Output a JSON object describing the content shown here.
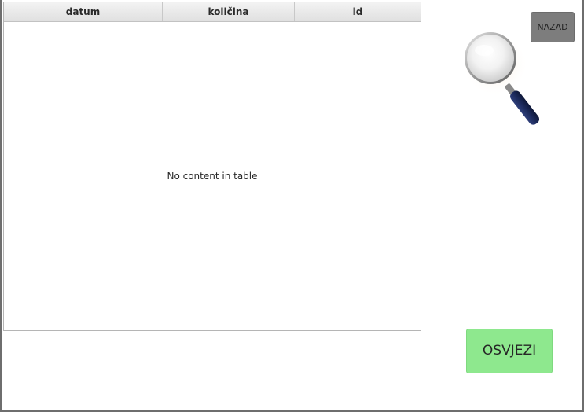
{
  "table": {
    "columns": [
      "datum",
      "količina",
      "id"
    ],
    "rows": [],
    "placeholder": "No content in table"
  },
  "buttons": {
    "back_label": "NAZAD",
    "refresh_label": "OSVJEZI"
  },
  "icons": {
    "search": "magnifying-glass"
  },
  "colors": {
    "refresh_button": "#8ee88e",
    "back_button": "#7d7d7d",
    "magnifier_handle": "#1c2a5c"
  }
}
